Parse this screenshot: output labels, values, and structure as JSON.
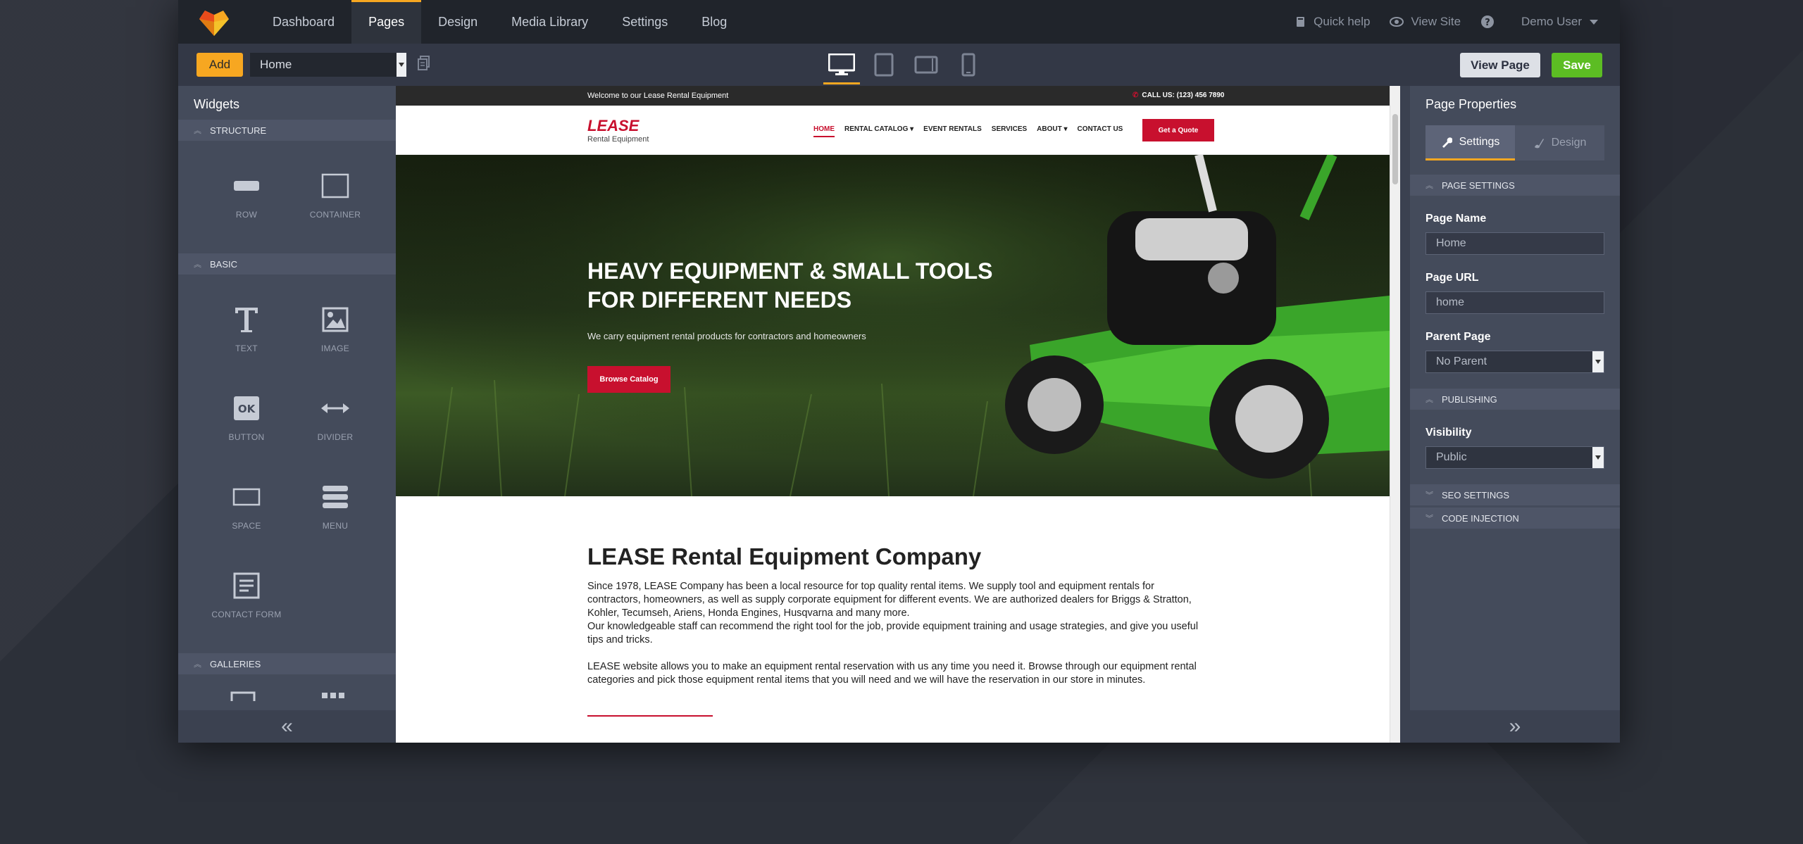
{
  "topnav": {
    "items": [
      {
        "label": "Dashboard",
        "active": false
      },
      {
        "label": "Pages",
        "active": true
      },
      {
        "label": "Design",
        "active": false
      },
      {
        "label": "Media Library",
        "active": false
      },
      {
        "label": "Settings",
        "active": false
      },
      {
        "label": "Blog",
        "active": false
      }
    ],
    "quick_help": "Quick help",
    "view_site": "View Site",
    "user": "Demo User"
  },
  "toolbar": {
    "add_label": "Add",
    "page_select_value": "Home",
    "view_page_label": "View Page",
    "save_label": "Save"
  },
  "widgets": {
    "title": "Widgets",
    "sections": [
      {
        "name": "STRUCTURE",
        "items": [
          {
            "label": "ROW",
            "icon": "row-icon"
          },
          {
            "label": "CONTAINER",
            "icon": "container-icon"
          }
        ]
      },
      {
        "name": "BASIC",
        "items": [
          {
            "label": "TEXT",
            "icon": "text-icon"
          },
          {
            "label": "IMAGE",
            "icon": "image-icon"
          },
          {
            "label": "BUTTON",
            "icon": "button-icon"
          },
          {
            "label": "DIVIDER",
            "icon": "divider-icon"
          },
          {
            "label": "SPACE",
            "icon": "space-icon"
          },
          {
            "label": "MENU",
            "icon": "menu-icon"
          },
          {
            "label": "CONTACT FORM",
            "icon": "contact-form-icon"
          }
        ]
      },
      {
        "name": "GALLERIES",
        "items": []
      }
    ],
    "button_icon_text": "OK"
  },
  "site": {
    "welcome": "Welcome to our Lease Rental Equipment",
    "call": "CALL US: (123) 456 7890",
    "brand_name": "LEASE",
    "brand_sub": "Rental Equipment",
    "menu": [
      {
        "label": "HOME",
        "active": true
      },
      {
        "label": "RENTAL CATALOG ▾",
        "active": false
      },
      {
        "label": "EVENT RENTALS",
        "active": false
      },
      {
        "label": "SERVICES",
        "active": false
      },
      {
        "label": "ABOUT ▾",
        "active": false
      },
      {
        "label": "CONTACT US",
        "active": false
      }
    ],
    "quote_label": "Get a Quote",
    "hero_title_line1": "HEAVY EQUIPMENT & SMALL TOOLS",
    "hero_title_line2": "FOR DIFFERENT NEEDS",
    "hero_sub": "We carry equipment rental products for contractors and homeowners",
    "browse_label": "Browse Catalog",
    "about_title": "LEASE Rental Equipment Company",
    "about_p1": "Since 1978, LEASE Company has been a local resource for top quality rental items. We supply tool and equipment rentals for contractors, homeowners, as well as supply corporate equipment for different events. We are authorized dealers for Briggs & Stratton, Kohler, Tecumseh, Ariens, Honda Engines, Husqvarna and many more.",
    "about_p2": "Our knowledgeable staff can recommend the right tool for the job, provide equipment training and usage strategies, and give you useful tips and tricks.",
    "about_p3": "LEASE website allows you to make an equipment rental reservation with us any time you need it. Browse through our equipment rental categories and pick those equipment rental items that you will need and we will have the reservation in our store in minutes."
  },
  "properties": {
    "title": "Page Properties",
    "tab_settings": "Settings",
    "tab_design": "Design",
    "section_page_settings": "PAGE SETTINGS",
    "page_name_label": "Page Name",
    "page_name_value": "Home",
    "page_url_label": "Page URL",
    "page_url_value": "home",
    "parent_page_label": "Parent Page",
    "parent_page_value": "No Parent",
    "section_publishing": "PUBLISHING",
    "visibility_label": "Visibility",
    "visibility_value": "Public",
    "section_seo": "SEO SETTINGS",
    "section_code": "CODE INJECTION"
  },
  "colors": {
    "accent": "#f7a721",
    "brand_red": "#c8102e",
    "save_green": "#5cbd23"
  }
}
